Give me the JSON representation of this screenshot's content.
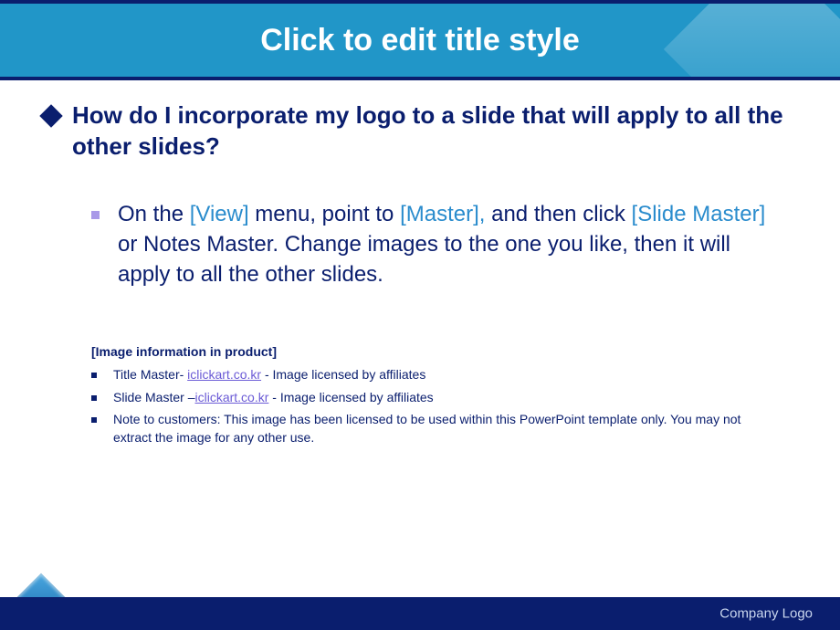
{
  "header": {
    "title": "Click to edit title style"
  },
  "question": "How do I incorporate my logo to a slide that will apply to all the other slides?",
  "answer": {
    "p1": "On the ",
    "hl1": "[View]",
    "p2": " menu, point to ",
    "hl2": "[Master],",
    "p3": " and then click ",
    "hl3": "[Slide Master]",
    "p4": " or Notes Master. Change images to the one you like, then it will apply to all the other slides."
  },
  "info": {
    "heading": "[Image information in product]",
    "items": [
      {
        "prefix": "Title Master- ",
        "link": "iclickart.co.kr",
        "suffix": "   - Image licensed by affiliates"
      },
      {
        "prefix": "Slide Master –",
        "link": "iclickart.co.kr",
        "suffix": "   - Image licensed by affiliates"
      },
      {
        "prefix": "Note to customers: This image has been licensed to be used within this PowerPoint template only. You may not extract the image for any other use.",
        "link": "",
        "suffix": ""
      }
    ]
  },
  "footer": {
    "text": "Company Logo"
  }
}
